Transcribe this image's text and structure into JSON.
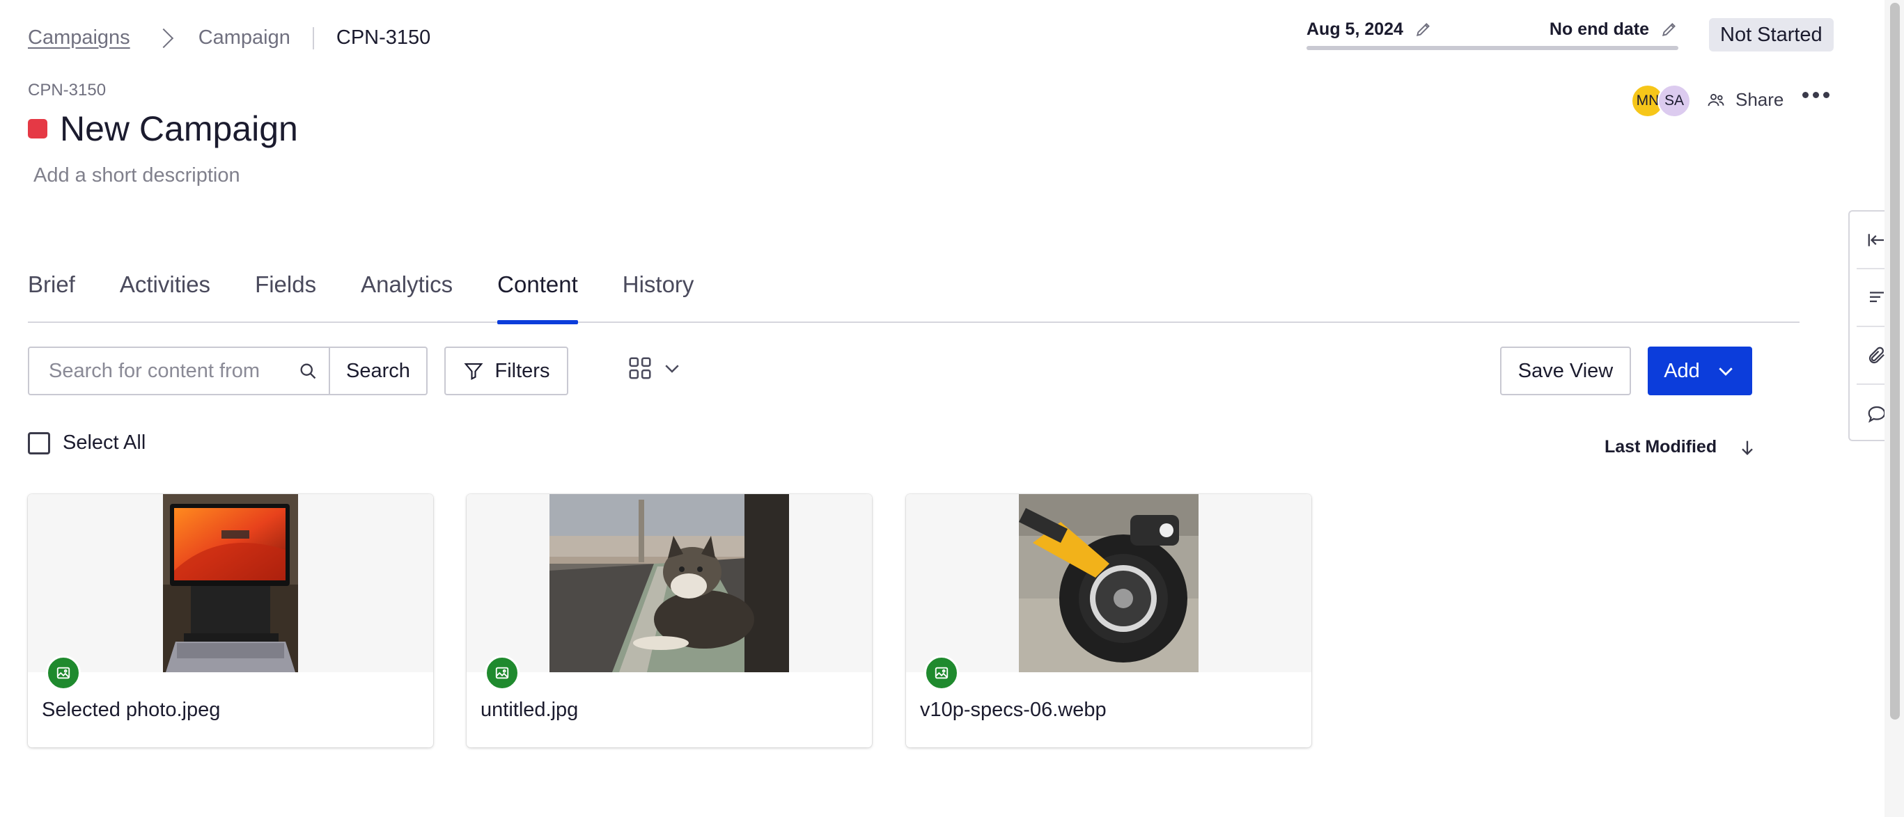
{
  "breadcrumb": {
    "root": "Campaigns",
    "parent": "Campaign",
    "current": "CPN-3150"
  },
  "dates": {
    "start": "Aug 5, 2024",
    "end": "No end date"
  },
  "status": "Not Started",
  "campaign": {
    "id": "CPN-3150",
    "title": "New Campaign",
    "color": "#e53945",
    "description_placeholder": "Add a short description"
  },
  "collaborators": [
    {
      "initials": "MN",
      "color": "#f6c619"
    },
    {
      "initials": "SA",
      "color": "#dccbef"
    }
  ],
  "share_label": "Share",
  "tabs": [
    {
      "label": "Brief"
    },
    {
      "label": "Activities"
    },
    {
      "label": "Fields"
    },
    {
      "label": "Analytics"
    },
    {
      "label": "Content",
      "active": true
    },
    {
      "label": "History"
    }
  ],
  "toolbar": {
    "search_placeholder": "Search for content from",
    "search_label": "Search",
    "filters_label": "Filters",
    "view_mode": "grid-icon",
    "save_view_label": "Save View",
    "add_label": "Add"
  },
  "select_all_label": "Select All",
  "sort": {
    "label": "Last Modified",
    "direction": "descending"
  },
  "content_items": [
    {
      "name": "Selected photo.jpeg",
      "type": "image"
    },
    {
      "name": "untitled.jpg",
      "type": "image"
    },
    {
      "name": "v10p-specs-06.webp",
      "type": "image"
    }
  ],
  "colors": {
    "accent": "#0c3ddb",
    "image_badge": "#1f8a2e",
    "status_bg": "#e6e7ee"
  },
  "rail_icons": [
    "collapse-left-icon",
    "outline-icon",
    "attachment-icon",
    "comment-icon"
  ]
}
